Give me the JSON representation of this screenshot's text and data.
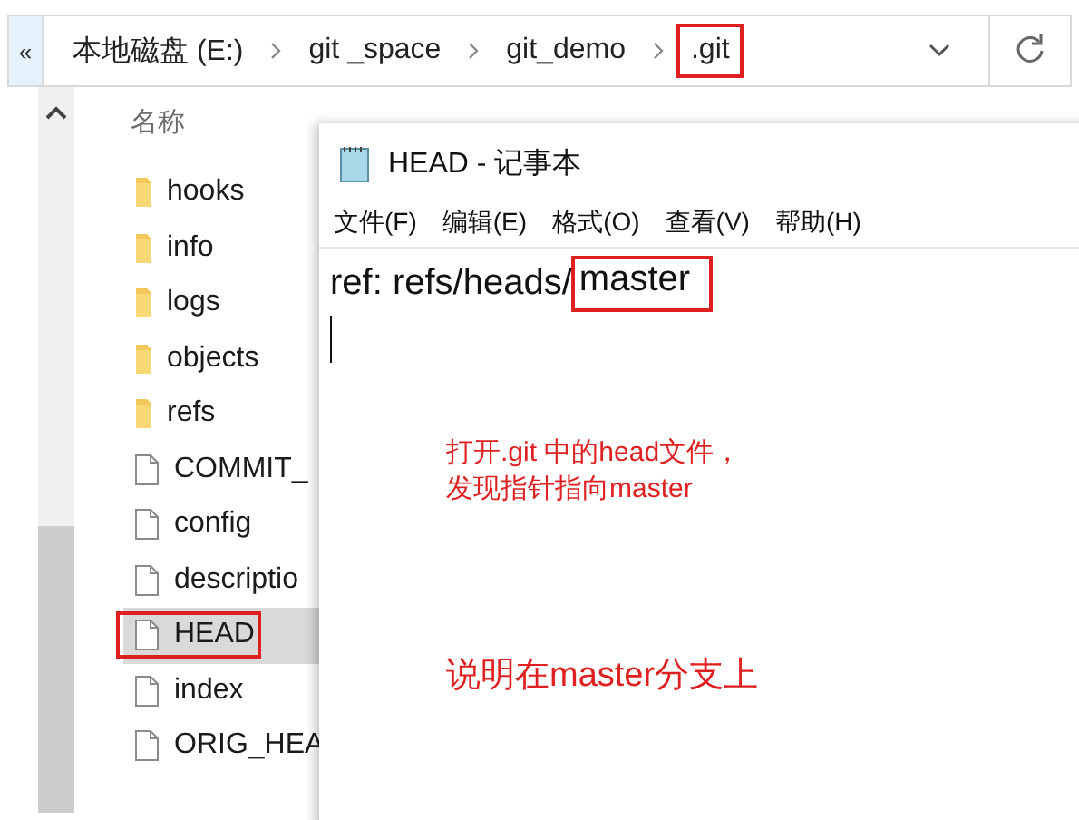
{
  "address_bar": {
    "back_glyph": "«",
    "crumbs": [
      {
        "label": "本地磁盘 (E:)",
        "marked": false
      },
      {
        "label": "git _space",
        "marked": false
      },
      {
        "label": "git_demo",
        "marked": false
      },
      {
        "label": ".git",
        "marked": true
      }
    ]
  },
  "file_list": {
    "column_header": "名称",
    "items": [
      {
        "name": "hooks",
        "kind": "folder",
        "selected": false,
        "marked": false
      },
      {
        "name": "info",
        "kind": "folder",
        "selected": false,
        "marked": false
      },
      {
        "name": "logs",
        "kind": "folder",
        "selected": false,
        "marked": false
      },
      {
        "name": "objects",
        "kind": "folder",
        "selected": false,
        "marked": false
      },
      {
        "name": "refs",
        "kind": "folder",
        "selected": false,
        "marked": false
      },
      {
        "name": "COMMIT_",
        "kind": "file",
        "selected": false,
        "marked": false
      },
      {
        "name": "config",
        "kind": "file",
        "selected": false,
        "marked": false
      },
      {
        "name": "descriptio",
        "kind": "file",
        "selected": false,
        "marked": false
      },
      {
        "name": "HEAD",
        "kind": "file",
        "selected": true,
        "marked": true
      },
      {
        "name": "index",
        "kind": "file",
        "selected": false,
        "marked": false
      },
      {
        "name": "ORIG_HEA",
        "kind": "file",
        "selected": false,
        "marked": false
      }
    ]
  },
  "notepad": {
    "title": "HEAD - 记事本",
    "menu": [
      "文件(F)",
      "编辑(E)",
      "格式(O)",
      "查看(V)",
      "帮助(H)"
    ],
    "content_prefix": "ref: refs/heads/",
    "content_marked": "master",
    "notes": [
      {
        "text": "打开.git 中的head文件，",
        "kind": "small"
      },
      {
        "text": "发现指针指向master",
        "kind": "small"
      },
      {
        "text": "说明在master分支上",
        "kind": "large"
      }
    ]
  }
}
